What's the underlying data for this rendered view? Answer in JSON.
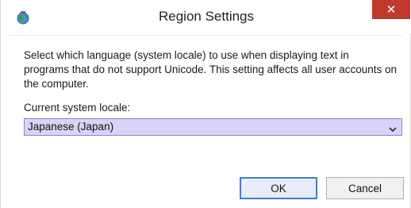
{
  "window": {
    "title": "Region Settings",
    "close_label": "✕",
    "app_icon": "globe-icon"
  },
  "main": {
    "description": "Select which language (system locale) to use when displaying text in programs that do not support Unicode. This setting affects all user accounts on the computer.",
    "locale_label": "Current system locale:",
    "locale_value": "Japanese (Japan)"
  },
  "buttons": {
    "ok_label": "OK",
    "cancel_label": "Cancel"
  },
  "colors": {
    "close_button": "#c0392b",
    "select_highlight": "#d8d4f7",
    "default_button_border": "#3b7fd1"
  }
}
